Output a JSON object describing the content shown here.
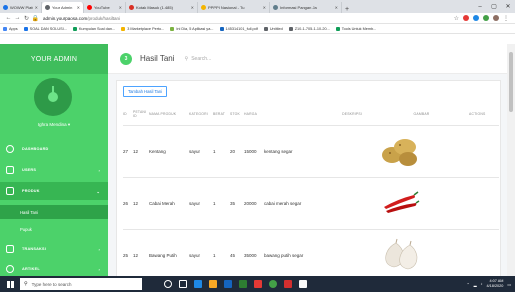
{
  "browser": {
    "tabs": [
      {
        "label": "WOWW Platform Ma",
        "color": "#1a73e8",
        "active": false
      },
      {
        "label": "Your Admin",
        "color": "#5f6368",
        "active": true
      },
      {
        "label": "YouTube",
        "color": "#ff0000",
        "active": false
      },
      {
        "label": "Kotak Masuk (1.485)",
        "color": "#d93025",
        "active": false
      },
      {
        "label": "PPPPI Nasional - Tu",
        "color": "#f4b400",
        "active": false
      },
      {
        "label": "Informasi Pangan Ja",
        "color": "#607d8b",
        "active": false
      }
    ],
    "address": {
      "host": "admin.yourpaosa.com",
      "path": "/produk/hasiltani"
    },
    "bookmarks": [
      {
        "label": "Apps",
        "color": "#4285f4"
      },
      {
        "label": "SOAL DAN SOLUSI...",
        "color": "#1a73e8"
      },
      {
        "label": "Kumpulan Soal dan...",
        "color": "#0f9d58"
      },
      {
        "label": "3 Marketplace Perto...",
        "color": "#f4b400"
      },
      {
        "label": "Ini Dia, 5 Aplikasi ya...",
        "color": "#7cb342"
      },
      {
        "label": "145314101_full.pdf",
        "color": "#1565c0"
      },
      {
        "label": "Untitled",
        "color": "#5f6368"
      },
      {
        "label": "Z10-1-705-1-10-20...",
        "color": "#5f6368"
      },
      {
        "label": "Tools Untuk Memb...",
        "color": "#0f9d58"
      }
    ]
  },
  "sidebar": {
    "brand": "YOUR ADMIN",
    "user": "Ighra Mendina",
    "items": [
      {
        "label": "DASHBOARD",
        "has_chevron": false
      },
      {
        "label": "USERS",
        "has_chevron": true
      },
      {
        "label": "PRODUK",
        "has_chevron": true
      },
      {
        "label": "TRANSAKSI",
        "has_chevron": true
      },
      {
        "label": "ARTIKEL",
        "has_chevron": true
      }
    ],
    "submenu": [
      {
        "label": "Hasil Tani",
        "active": true
      },
      {
        "label": "Pupuk",
        "active": false
      }
    ]
  },
  "header": {
    "step": "3",
    "title": "Hasil Tani",
    "search_placeholder": "Search..."
  },
  "main": {
    "add_button": "Tambah Hasil Tani",
    "columns": [
      "ID",
      "PETANI ID",
      "NAMA PRODUK",
      "KATEGORI",
      "BERAT",
      "STOK",
      "HARGA",
      "DESKRIPSI",
      "GAMBAR",
      "ACTIONS"
    ],
    "rows": [
      {
        "id": "27",
        "petani": "12",
        "nama": "Kentang",
        "kategori": "sayur",
        "berat": "1",
        "stok": "20",
        "harga": "15000",
        "deskripsi": "kentang segar",
        "gambar": "potato-image"
      },
      {
        "id": "26",
        "petani": "12",
        "nama": "Cabai Merah",
        "kategori": "sayur",
        "berat": "1",
        "stok": "35",
        "harga": "20000",
        "deskripsi": "cabai merah segar",
        "gambar": "chili-image"
      },
      {
        "id": "25",
        "petani": "12",
        "nama": "Bawang Putih",
        "kategori": "sayur",
        "berat": "1",
        "stok": "45",
        "harga": "35000",
        "deskripsi": "bawang putih segar",
        "gambar": "garlic-image"
      }
    ]
  },
  "taskbar": {
    "search_placeholder": "Type here to search",
    "time": "4:07 AM",
    "date": "4/18/2020"
  },
  "colors": {
    "accent": "#4cd26a",
    "accent_dark": "#3fbd5c",
    "link_blue": "#1f7ae0",
    "taskbar": "#1f2a3a"
  }
}
